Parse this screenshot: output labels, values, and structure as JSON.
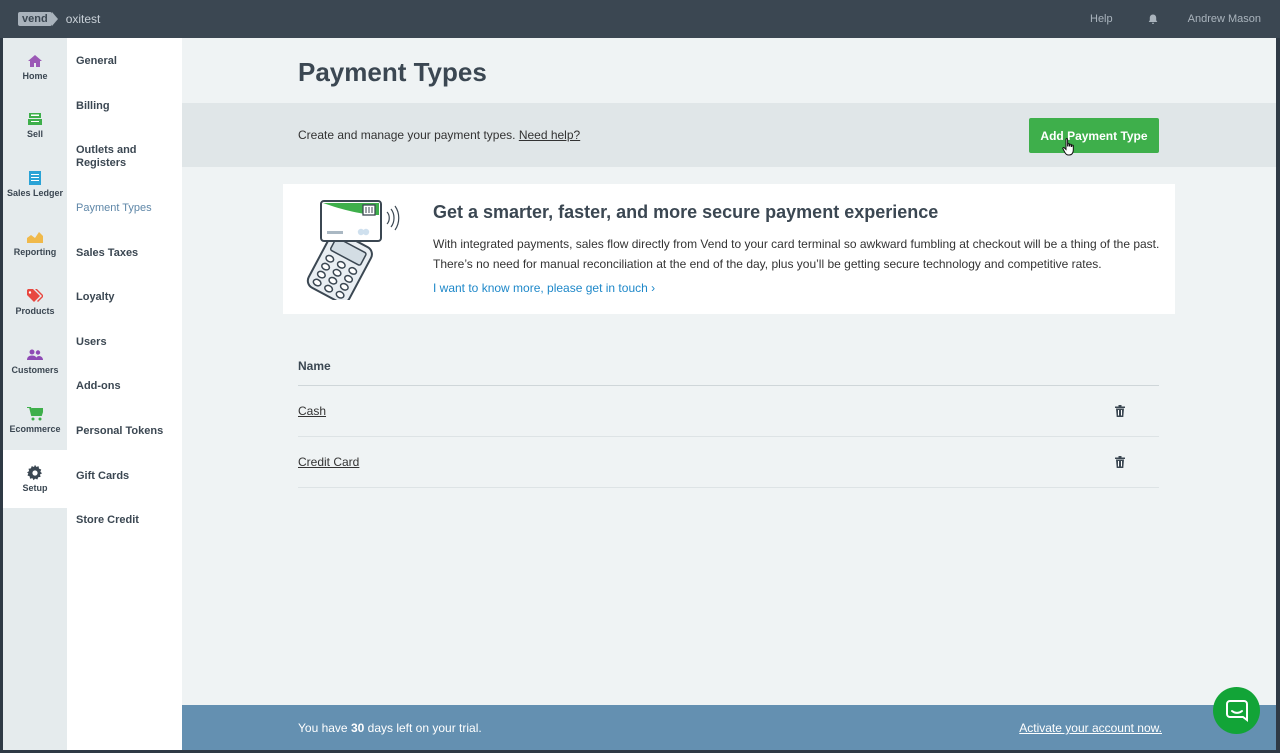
{
  "topbar": {
    "logo": "vend",
    "store": "oxitest",
    "help": "Help",
    "user": "Andrew Mason"
  },
  "rail": [
    {
      "label": "Home",
      "icon": "home-icon",
      "color": "#9b59b6"
    },
    {
      "label": "Sell",
      "icon": "register-icon",
      "color": "#3eaf4b"
    },
    {
      "label": "Sales Ledger",
      "icon": "ledger-icon",
      "color": "#2aa3d6"
    },
    {
      "label": "Reporting",
      "icon": "chart-icon",
      "color": "#f0b94a"
    },
    {
      "label": "Products",
      "icon": "tag-icon",
      "color": "#e8473f"
    },
    {
      "label": "Customers",
      "icon": "people-icon",
      "color": "#8e4ab5"
    },
    {
      "label": "Ecommerce",
      "icon": "cart-icon",
      "color": "#3eaf4b"
    },
    {
      "label": "Setup",
      "icon": "gear-icon",
      "color": "#3b4752"
    }
  ],
  "subnav": [
    "General",
    "Billing",
    "Outlets and Registers",
    "Payment Types",
    "Sales Taxes",
    "Loyalty",
    "Users",
    "Add-ons",
    "Personal Tokens",
    "Gift Cards",
    "Store Credit"
  ],
  "page": {
    "title": "Payment Types",
    "description": "Create and manage your payment types.",
    "help_link": "Need help?",
    "add_button": "Add Payment Type"
  },
  "promo": {
    "title": "Get a smarter, faster, and more secure payment experience",
    "body": "With integrated payments, sales flow directly from Vend to your card terminal so awkward fumbling at checkout will be a thing of the past. There’s no need for manual reconciliation at the end of the day, plus you’ll be getting secure technology and competitive rates.",
    "link": "I want to know more, please get in touch ›"
  },
  "table": {
    "header": "Name",
    "rows": [
      "Cash",
      "Credit Card"
    ]
  },
  "trial": {
    "prefix": "You have",
    "days": "30",
    "suffix": "days left on your trial.",
    "link": "Activate your account now."
  }
}
